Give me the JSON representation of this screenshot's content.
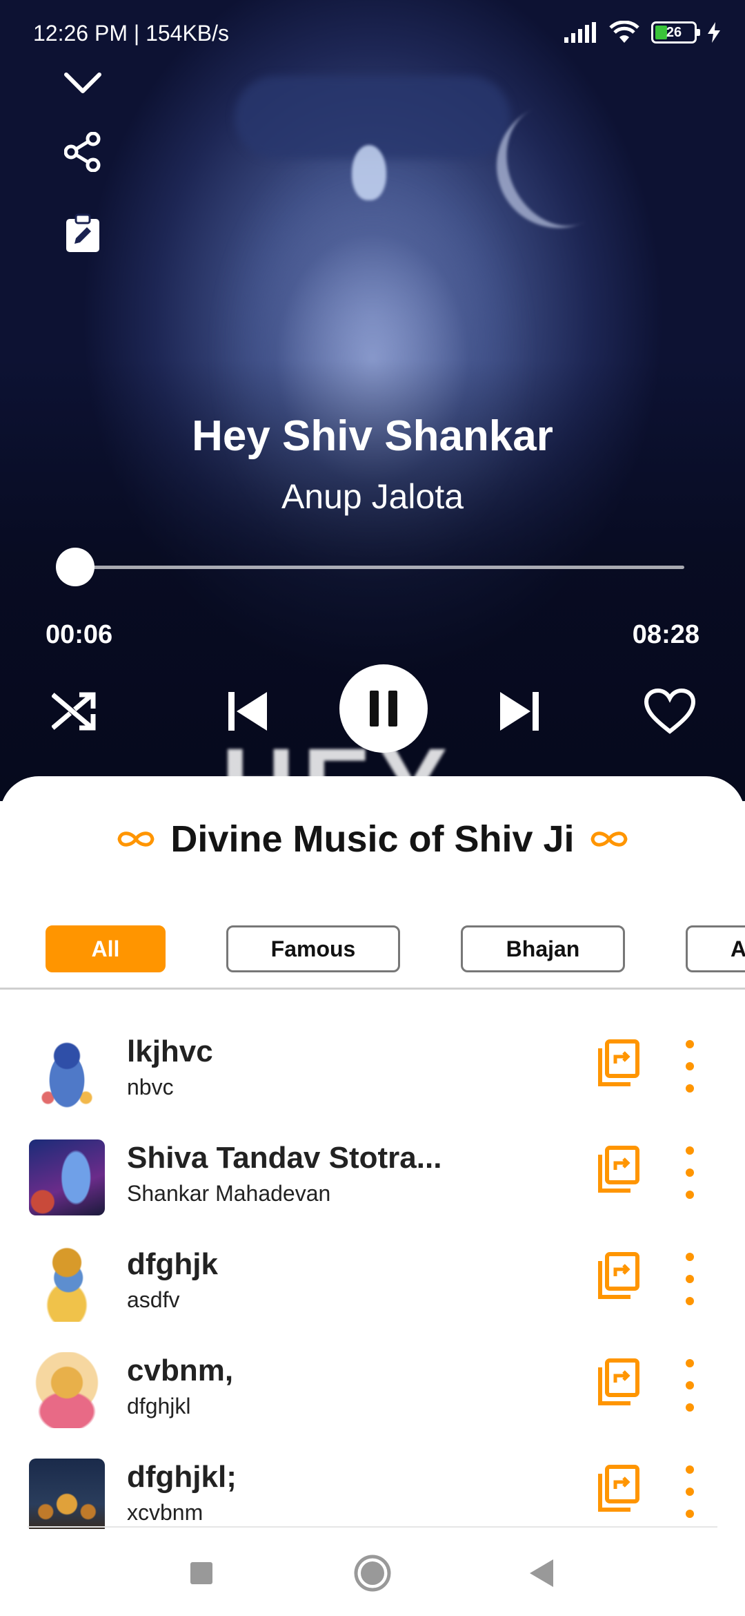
{
  "status_bar": {
    "time": "12:26 PM | 154KB/s",
    "battery": "26"
  },
  "player": {
    "title": "Hey Shiv Shankar",
    "artist": "Anup Jalota",
    "elapsed": "00:06",
    "total": "08:28",
    "progress_fraction": 0.012,
    "album_art_text": "HEY",
    "side_buttons": [
      "collapse-chevron-icon",
      "share-icon",
      "edit-clipboard-icon"
    ],
    "controls": [
      "shuffle-icon",
      "previous-icon",
      "pause-icon",
      "next-icon",
      "heart-icon"
    ]
  },
  "sheet": {
    "title": "Divine Music of Shiv Ji",
    "accent_color": "#ff9500",
    "chips": [
      {
        "label": "All",
        "active": true
      },
      {
        "label": "Famous",
        "active": false
      },
      {
        "label": "Bhajan",
        "active": false
      },
      {
        "label": "A",
        "active": false
      }
    ],
    "songs": [
      {
        "title": "lkjhvc",
        "subtitle": "nbvc",
        "thumb": "krishna-art"
      },
      {
        "title": "Shiva Tandav Stotra...",
        "subtitle": "Shankar Mahadevan",
        "thumb": "shiva-tandav-art"
      },
      {
        "title": "dfghjk",
        "subtitle": "asdfv",
        "thumb": "krishna-flute-art"
      },
      {
        "title": "cvbnm,",
        "subtitle": "dfghjkl",
        "thumb": "lakshmi-art"
      },
      {
        "title": "dfghjkl;",
        "subtitle": "xcvbnm",
        "thumb": "temple-art"
      }
    ]
  },
  "navbar": [
    "recents-square-icon",
    "home-circle-icon",
    "back-triangle-icon"
  ]
}
